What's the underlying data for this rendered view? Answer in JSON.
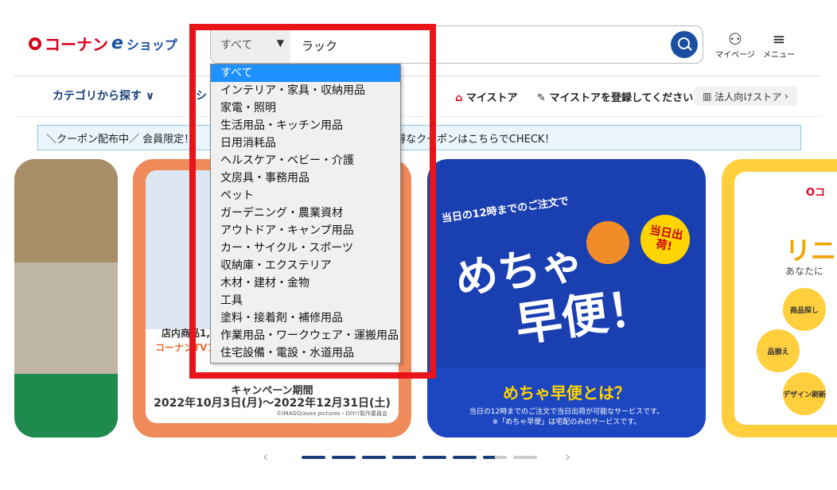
{
  "header": {
    "logo_main": "コーナン",
    "logo_e": "e",
    "logo_shop": "ショップ",
    "mypage_label": "マイページ",
    "menu_label": "メニュー"
  },
  "search": {
    "category_selected": "すべて",
    "query_value": "ラック"
  },
  "nav": {
    "category_label": "カテゴリから探す",
    "partial_label": "シ",
    "mystore_label": "マイストア",
    "register_store_label": "マイストアを登録してください",
    "corporate_label": "法人向けストア"
  },
  "coupon": {
    "text": "＼クーポン配布中／ 会員限定！",
    "text2": "▼お得なクーポンはこちらでCHECK！"
  },
  "banners": {
    "b2_shop1": "店内商品1,0",
    "b2_shop2": "コーナンTVア",
    "b2_campaign_title": "キャンペーン期間",
    "b2_campaign_dates": "2022年10月3日(月)〜2022年12月31日(土)",
    "b2_copyright": "©IMAGO/avex pictures・DIY!!製作委員会",
    "b3_lead": "当日の12時までのご注文で",
    "b3_big1": "めちゃ",
    "b3_big2": "早便！",
    "b3_badge": "当日出荷!",
    "b3_title": "めちゃ早便とは？",
    "b3_sub1": "当日の12時までのご注文で当日出荷が可能なサービスです。",
    "b3_sub2": "※「めちゃ早便」は宅配のみのサービスです。",
    "b4_logo": "Oコ",
    "b4_ri": "リニ",
    "b4_ana": "あなたに",
    "b4_bubble1": "商品探し",
    "b4_bubble2": "品揃え",
    "b4_bubble3": "デザイン刷新"
  },
  "dropdown": {
    "options": [
      "すべて",
      "インテリア・家具・収納用品",
      "家電・照明",
      "生活用品・キッチン用品",
      "日用消耗品",
      "ヘルスケア・ベビー・介護",
      "文房具・事務用品",
      "ペット",
      "ガーデニング・農業資材",
      "アウトドア・キャンプ用品",
      "カー・サイクル・スポーツ",
      "収納庫・エクステリア",
      "木材・建材・金物",
      "工具",
      "塗料・接着剤・補修用品",
      "作業用品・ワークウェア・運搬用品",
      "住宅設備・電設・水道用品"
    ]
  },
  "colors": {
    "brand_red": "#d6001c",
    "brand_blue": "#1a4ea1",
    "highlight_red": "#e8141a",
    "selected_option": "#1e90ff"
  }
}
